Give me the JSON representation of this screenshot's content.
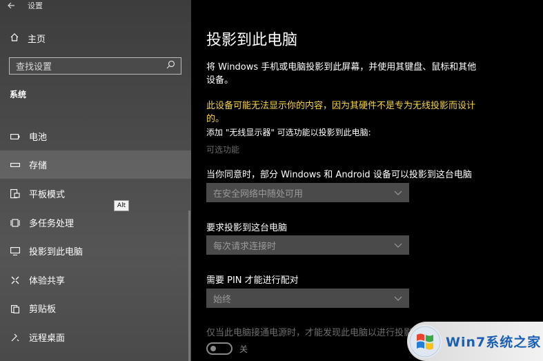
{
  "sidebar": {
    "back_title": "设置",
    "home_label": "主页",
    "search_placeholder": "查找设置",
    "section": "系统",
    "items": [
      {
        "label": "电池"
      },
      {
        "label": "存储"
      },
      {
        "label": "平板模式"
      },
      {
        "label": "多任务处理"
      },
      {
        "label": "投影到此电脑"
      },
      {
        "label": "体验共享"
      },
      {
        "label": "剪贴板"
      },
      {
        "label": "远程桌面"
      }
    ],
    "tooltip": "Alt"
  },
  "main": {
    "title": "投影到此电脑",
    "description": "将 Windows 手机或电脑投影到此屏幕，并使用其键盘、鼠标和其他设备。",
    "warning": "此设备可能无法显示你的内容，因为其硬件不是专为无线投影而设计的。",
    "add_text": "添加 \"无线显示器\" 可选功能以投影到此电脑:",
    "optional_features": "可选功能",
    "setting1_label": "当你同意时，部分 Windows 和 Android 设备可以投影到这台电脑",
    "setting1_value": "在安全网络中随处可用",
    "setting2_label": "要求投影到这台电脑",
    "setting2_value": "每次请求连接时",
    "setting3_label": "需要 PIN 才能进行配对",
    "setting3_value": "始终",
    "power_label": "仅当此电脑接通电源时，才能发现此电脑以进行投影",
    "toggle_state": "关"
  },
  "watermark": {
    "text": "Win7系统之家"
  }
}
